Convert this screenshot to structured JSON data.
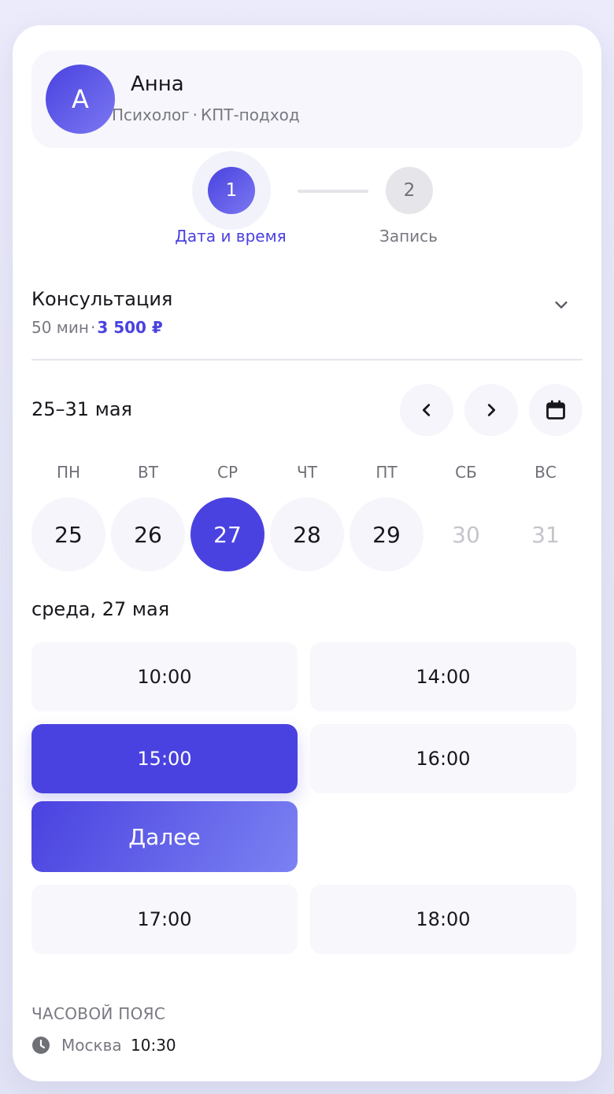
{
  "provider": {
    "avatar_initial": "А",
    "name": "Анна",
    "role": "Психолог",
    "separator": "·",
    "approach": "КПТ-подход"
  },
  "stepper": {
    "steps": [
      {
        "number": "1",
        "label": "Дата и время",
        "state": "active"
      },
      {
        "number": "2",
        "label": "Запись",
        "state": "inactive"
      }
    ]
  },
  "service": {
    "title": "Консультация",
    "duration": "50 мин",
    "separator": "·",
    "price": "3 500 ₽"
  },
  "week": {
    "range": "25–31 мая",
    "icons": {
      "prev": "chevron-left-icon",
      "next": "chevron-right-icon",
      "calendar": "calendar-icon"
    }
  },
  "days": [
    {
      "dow": "ПН",
      "date": "25",
      "state": "available"
    },
    {
      "dow": "ВТ",
      "date": "26",
      "state": "available"
    },
    {
      "dow": "СР",
      "date": "27",
      "state": "selected"
    },
    {
      "dow": "ЧТ",
      "date": "28",
      "state": "available"
    },
    {
      "dow": "ПТ",
      "date": "29",
      "state": "available"
    },
    {
      "dow": "СБ",
      "date": "30",
      "state": "disabled"
    },
    {
      "dow": "ВС",
      "date": "31",
      "state": "disabled"
    }
  ],
  "selected_day_heading": "среда, 27 мая",
  "slots": [
    {
      "time": "10:00",
      "state": "available"
    },
    {
      "time": "14:00",
      "state": "available"
    },
    {
      "time": "15:00",
      "state": "selected"
    },
    {
      "time": "16:00",
      "state": "available"
    },
    {
      "time": "17:00",
      "state": "available"
    },
    {
      "time": "18:00",
      "state": "available"
    }
  ],
  "next_button_label": "Далее",
  "timezone": {
    "label": "ЧАСОВОЙ ПОЯС",
    "city": "Москва",
    "time": "10:30",
    "icon": "clock-icon"
  },
  "colors": {
    "accent": "#4a42e0",
    "accent_light": "#7b78f1",
    "surface": "#f6f6fc",
    "muted_text": "#787882",
    "disabled_text": "#c4c4cc"
  }
}
